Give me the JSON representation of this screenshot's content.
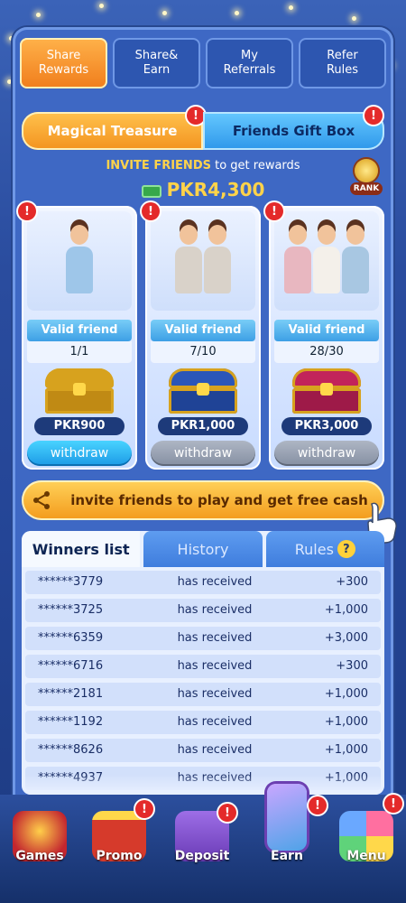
{
  "top_tabs": [
    {
      "line1": "Share",
      "line2": "Rewards"
    },
    {
      "line1": "Share&",
      "line2": "Earn"
    },
    {
      "line1": "My",
      "line2": "Referrals"
    },
    {
      "line1": "Refer",
      "line2": "Rules"
    }
  ],
  "section_tabs": {
    "left": "Magical Treasure",
    "right": "Friends Gift Box"
  },
  "invite_header": {
    "highlight": "INVITE FRIENDS",
    "rest": " to get  rewards",
    "total": "PKR4,300",
    "rank_label": "RANK"
  },
  "cards": [
    {
      "valid_label": "Valid friend",
      "count": "1/1",
      "amount": "PKR900",
      "button": "withdraw",
      "chest_color": "#d7a21e"
    },
    {
      "valid_label": "Valid friend",
      "count": "7/10",
      "amount": "PKR1,000",
      "button": "withdraw",
      "chest_color": "#2b56b8"
    },
    {
      "valid_label": "Valid friend",
      "count": "28/30",
      "amount": "PKR3,000",
      "button": "withdraw",
      "chest_color": "#c2245a"
    }
  ],
  "invite_bar": {
    "text": "invite friends to play and get free cash"
  },
  "bottom_tabs": {
    "winners": "Winners list",
    "history": "History",
    "rules": "Rules",
    "rules_icon": "?"
  },
  "winners": [
    {
      "user": "******3779",
      "msg": "has received",
      "value": "+300"
    },
    {
      "user": "******3725",
      "msg": "has received",
      "value": "+1,000"
    },
    {
      "user": "******6359",
      "msg": "has received",
      "value": "+3,000"
    },
    {
      "user": "******6716",
      "msg": "has received",
      "value": "+300"
    },
    {
      "user": "******2181",
      "msg": "has received",
      "value": "+1,000"
    },
    {
      "user": "******1192",
      "msg": "has received",
      "value": "+1,000"
    },
    {
      "user": "******8626",
      "msg": "has received",
      "value": "+1,000"
    },
    {
      "user": "******4937",
      "msg": "has received",
      "value": "+1,000"
    }
  ],
  "nav": [
    {
      "label": "Games",
      "color": "#c3262f",
      "icon": "slot-machine-icon"
    },
    {
      "label": "Promo",
      "color": "#d63a2b",
      "icon": "gift-icon"
    },
    {
      "label": "Deposit",
      "color": "#7a4bc4",
      "icon": "wallet-icon"
    },
    {
      "label": "Earn",
      "color": "#4fa3e8",
      "icon": "phone-icon"
    },
    {
      "label": "Menu",
      "color": "#5d6fd6",
      "icon": "menu-grid-icon"
    }
  ],
  "alert_glyph": "!"
}
